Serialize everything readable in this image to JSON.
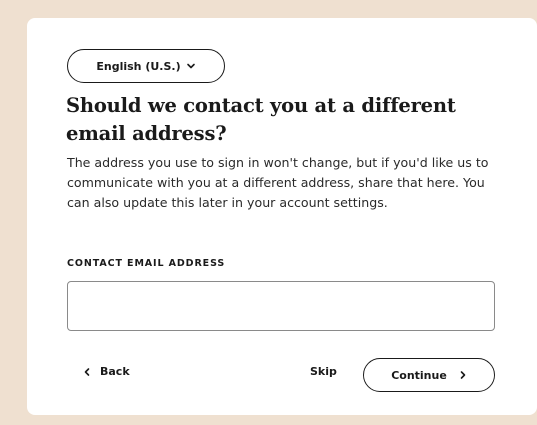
{
  "language_selector": {
    "label": "English (U.S.)",
    "icon": "chevron-down-icon"
  },
  "heading": "Should we contact you at a different email address?",
  "description": "The address you use to sign in won't change, but if you'd like us to communicate with you at a different address, share that here. You can also update this later in your account settings.",
  "contact_email": {
    "label": "CONTACT EMAIL ADDRESS",
    "value": "",
    "placeholder": ""
  },
  "actions": {
    "back_label": "Back",
    "back_icon": "chevron-left-icon",
    "skip_label": "Skip",
    "continue_label": "Continue",
    "continue_icon": "chevron-right-icon"
  },
  "colors": {
    "page_background": "#efe0d0",
    "card_background": "#ffffff",
    "text": "#1a1a1a",
    "input_border": "#8a8a8a"
  }
}
